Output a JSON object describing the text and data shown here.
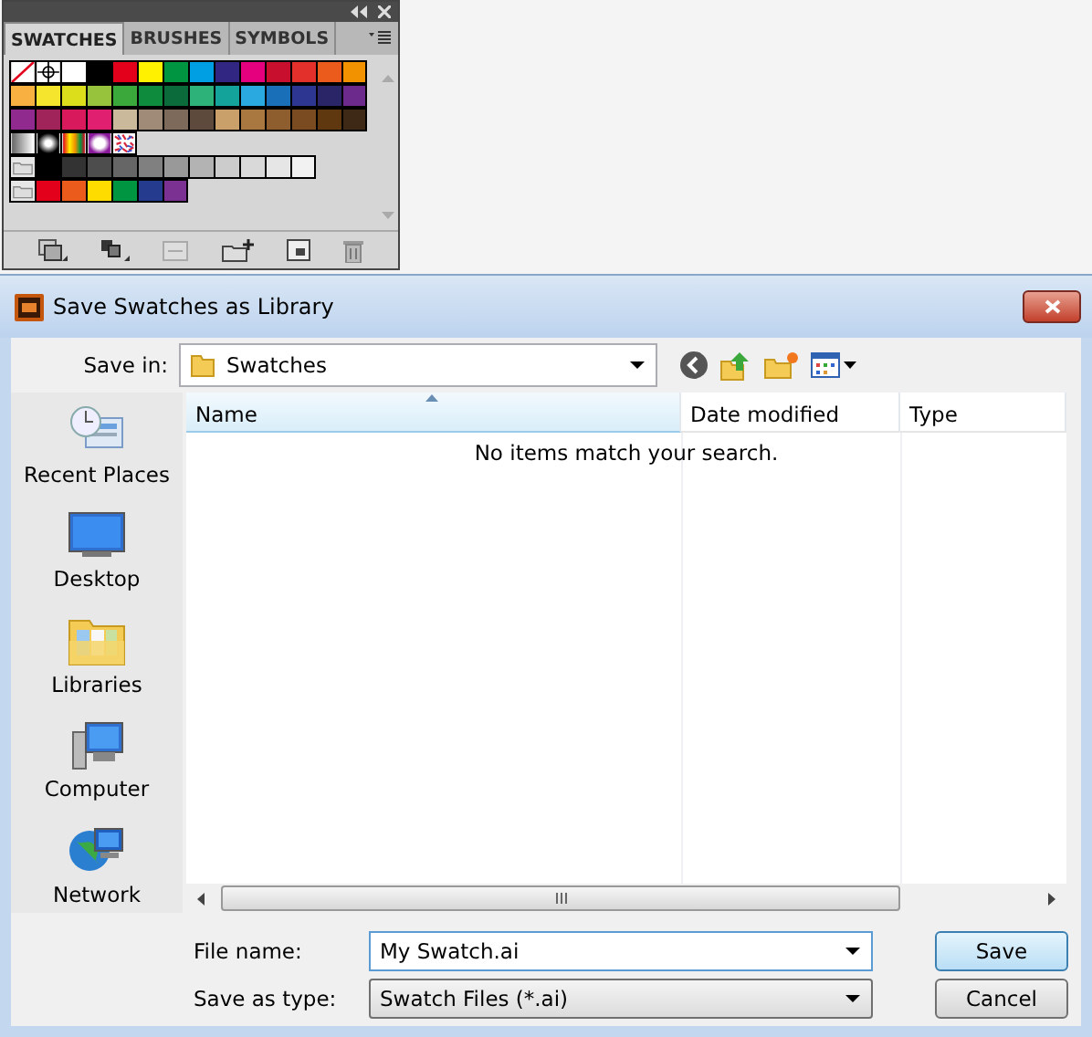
{
  "swatches_panel": {
    "tabs": [
      {
        "label": "SWATCHES",
        "selected": true
      },
      {
        "label": "BRUSHES",
        "selected": false
      },
      {
        "label": "SYMBOLS",
        "selected": false
      }
    ],
    "swatch_rows": [
      [
        {
          "kind": "none"
        },
        {
          "kind": "registration"
        },
        {
          "kind": "solid",
          "color": "#ffffff"
        },
        {
          "kind": "solid",
          "color": "#000000"
        },
        {
          "kind": "solid",
          "color": "#e3001b"
        },
        {
          "kind": "solid",
          "color": "#fff100"
        },
        {
          "kind": "solid",
          "color": "#009641"
        },
        {
          "kind": "solid",
          "color": "#009fe3"
        },
        {
          "kind": "solid",
          "color": "#312783"
        },
        {
          "kind": "solid",
          "color": "#e5007d"
        },
        {
          "kind": "solid",
          "color": "#c8102e"
        },
        {
          "kind": "solid",
          "color": "#e3302b"
        },
        {
          "kind": "solid",
          "color": "#ea5b1c"
        },
        {
          "kind": "solid",
          "color": "#f39200"
        }
      ],
      [
        {
          "kind": "solid",
          "color": "#f8b040"
        },
        {
          "kind": "solid",
          "color": "#f5e52c"
        },
        {
          "kind": "solid",
          "color": "#dcde1c"
        },
        {
          "kind": "solid",
          "color": "#97c33c"
        },
        {
          "kind": "solid",
          "color": "#3aa83a"
        },
        {
          "kind": "solid",
          "color": "#0e8b3d"
        },
        {
          "kind": "solid",
          "color": "#0b6b3a"
        },
        {
          "kind": "solid",
          "color": "#2db37a"
        },
        {
          "kind": "solid",
          "color": "#14a39a"
        },
        {
          "kind": "solid",
          "color": "#2aa8e0"
        },
        {
          "kind": "solid",
          "color": "#1a70b8"
        },
        {
          "kind": "solid",
          "color": "#2d3691"
        },
        {
          "kind": "solid",
          "color": "#2a2566"
        },
        {
          "kind": "solid",
          "color": "#6b2a8c"
        }
      ],
      [
        {
          "kind": "solid",
          "color": "#902a8f"
        },
        {
          "kind": "solid",
          "color": "#a0245a"
        },
        {
          "kind": "solid",
          "color": "#d81a5c"
        },
        {
          "kind": "solid",
          "color": "#e01f70"
        },
        {
          "kind": "solid",
          "color": "#cbb99b"
        },
        {
          "kind": "solid",
          "color": "#a08a78"
        },
        {
          "kind": "solid",
          "color": "#7e6a5a"
        },
        {
          "kind": "solid",
          "color": "#5e4a3c"
        },
        {
          "kind": "solid",
          "color": "#c9a06a"
        },
        {
          "kind": "solid",
          "color": "#a87840"
        },
        {
          "kind": "solid",
          "color": "#8e5e2e"
        },
        {
          "kind": "solid",
          "color": "#7a4a20"
        },
        {
          "kind": "solid",
          "color": "#603810"
        },
        {
          "kind": "solid",
          "color": "#3e2816"
        }
      ],
      [
        {
          "kind": "fade"
        },
        {
          "kind": "radial"
        },
        {
          "kind": "rainbow"
        },
        {
          "kind": "radial-purple"
        },
        {
          "kind": "pattern"
        }
      ],
      [
        {
          "kind": "folder"
        },
        {
          "kind": "solid",
          "color": "#000000"
        },
        {
          "kind": "solid",
          "color": "#333333"
        },
        {
          "kind": "solid",
          "color": "#4d4d4d"
        },
        {
          "kind": "solid",
          "color": "#666666"
        },
        {
          "kind": "solid",
          "color": "#808080"
        },
        {
          "kind": "solid",
          "color": "#999999"
        },
        {
          "kind": "solid",
          "color": "#b3b3b3"
        },
        {
          "kind": "solid",
          "color": "#cccccc"
        },
        {
          "kind": "solid",
          "color": "#d9d9d9"
        },
        {
          "kind": "solid",
          "color": "#e6e6e6"
        },
        {
          "kind": "solid",
          "color": "#f2f2f2"
        }
      ],
      [
        {
          "kind": "folder"
        },
        {
          "kind": "solid",
          "color": "#e3001b"
        },
        {
          "kind": "solid",
          "color": "#ea5b1c"
        },
        {
          "kind": "solid",
          "color": "#ffdc00"
        },
        {
          "kind": "solid",
          "color": "#009641"
        },
        {
          "kind": "solid",
          "color": "#253c8e"
        },
        {
          "kind": "solid",
          "color": "#7b3191"
        }
      ]
    ]
  },
  "dialog": {
    "title": "Save Swatches as Library",
    "save_in": {
      "label": "Save in:",
      "value": "Swatches"
    },
    "places": [
      {
        "kind": "recent",
        "label": "Recent Places"
      },
      {
        "kind": "desktop",
        "label": "Desktop"
      },
      {
        "kind": "libraries",
        "label": "Libraries"
      },
      {
        "kind": "computer",
        "label": "Computer"
      },
      {
        "kind": "network",
        "label": "Network"
      }
    ],
    "columns": [
      {
        "label": "Name",
        "selected": true
      },
      {
        "label": "Date modified",
        "selected": false
      },
      {
        "label": "Type",
        "selected": false
      }
    ],
    "empty_message": "No items match your search.",
    "file_name": {
      "label": "File name:",
      "value": "My Swatch.ai"
    },
    "save_as_type": {
      "label": "Save as type:",
      "value": "Swatch Files (*.ai)"
    },
    "buttons": [
      {
        "label": "Save",
        "default": true
      },
      {
        "label": "Cancel",
        "default": false
      }
    ]
  }
}
